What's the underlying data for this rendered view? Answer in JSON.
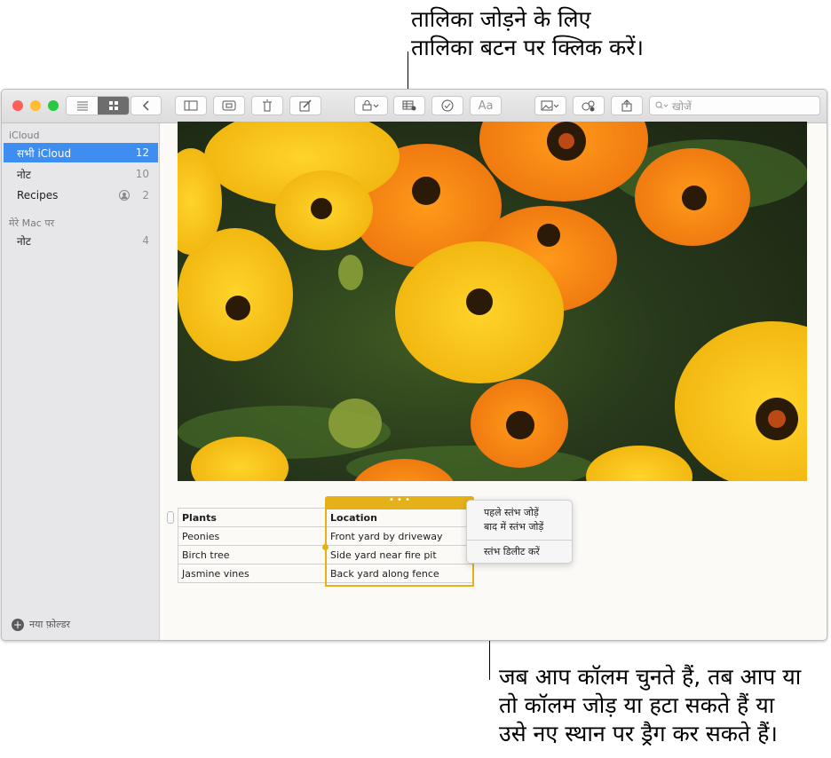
{
  "callouts": {
    "top_line1": "तालिका जोड़ने के लिए",
    "top_line2": "तालिका बटन पर क्लिक करें।",
    "bottom_line1": "जब आप कॉलम चुनते हैं, तब आप या",
    "bottom_line2": "तो कॉलम जोड़ या हटा सकते हैं या",
    "bottom_line3": "उसे नए स्थान पर ड्रैग कर सकते हैं।"
  },
  "toolbar": {
    "format_label": "Aa",
    "search_placeholder": "खोजें",
    "icons": [
      "list-view-icon",
      "gallery-view-icon",
      "back-icon",
      "sidebar-icon",
      "attachments-icon",
      "trash-icon",
      "compose-icon",
      "lock-icon",
      "table-icon",
      "checklist-icon",
      "format-icon",
      "media-icon",
      "share-person-icon",
      "share-icon",
      "search-icon"
    ]
  },
  "sidebar": {
    "icloud_header": "iCloud",
    "items": [
      {
        "label": "सभी iCloud",
        "count": "12",
        "selected": true
      },
      {
        "label": "नोट",
        "count": "10"
      },
      {
        "label": "Recipes",
        "count": "2",
        "shared": true
      }
    ],
    "mac_header": "मेरे Mac पर",
    "mac_items": [
      {
        "label": "नोट",
        "count": "4"
      }
    ],
    "new_folder": "नया फ़ोल्डर"
  },
  "table": {
    "headers": [
      "Plants",
      "Location"
    ],
    "rows": [
      [
        "Peonies",
        "Front yard by driveway"
      ],
      [
        "Birch tree",
        "Side yard near fire pit"
      ],
      [
        "Jasmine vines",
        "Back yard along fence"
      ]
    ],
    "column_handle": "• • •"
  },
  "context_menu": {
    "items": [
      "पहले स्तंभ जोड़ें",
      "बाद में स्तंभ जोड़ें",
      "स्तंभ डिलीट करें"
    ]
  },
  "colors": {
    "accent": "#3d8ef0",
    "selection": "#e5b11b"
  }
}
